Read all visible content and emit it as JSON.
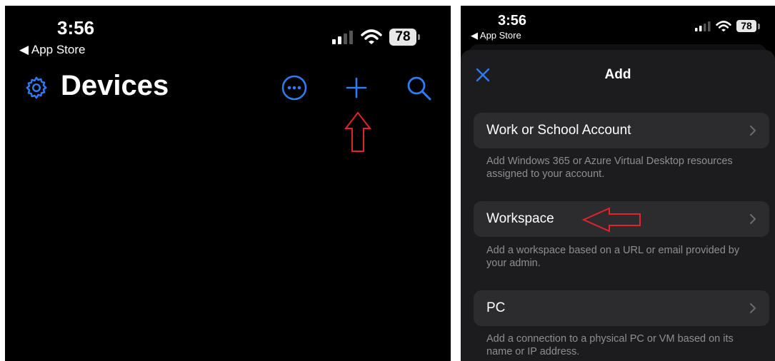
{
  "left": {
    "status": {
      "time": "3:56",
      "back_label": "◀ App Store",
      "battery": "78"
    },
    "title": "Devices"
  },
  "right": {
    "status": {
      "time": "3:56",
      "back_label": "◀ App Store",
      "battery": "78"
    },
    "sheet_title": "Add",
    "options": [
      {
        "label": "Work or School Account",
        "description": "Add Windows 365 or Azure Virtual Desktop resources assigned to your account."
      },
      {
        "label": "Workspace",
        "description": "Add a workspace based on a URL or email provided by your admin."
      },
      {
        "label": "PC",
        "description": "Add a connection to a physical PC or VM based on its name or IP address."
      }
    ]
  },
  "colors": {
    "accent": "#2f7cf6",
    "annotation": "#e0242a",
    "sheet": "#1c1c1e",
    "row": "#2c2c2e",
    "secondary_text": "#8e8e93"
  },
  "icons": [
    "gear-icon",
    "more-icon",
    "plus-icon",
    "search-icon",
    "close-icon",
    "chevron-right-icon",
    "cellular-signal-icon",
    "wifi-icon",
    "battery-icon"
  ]
}
